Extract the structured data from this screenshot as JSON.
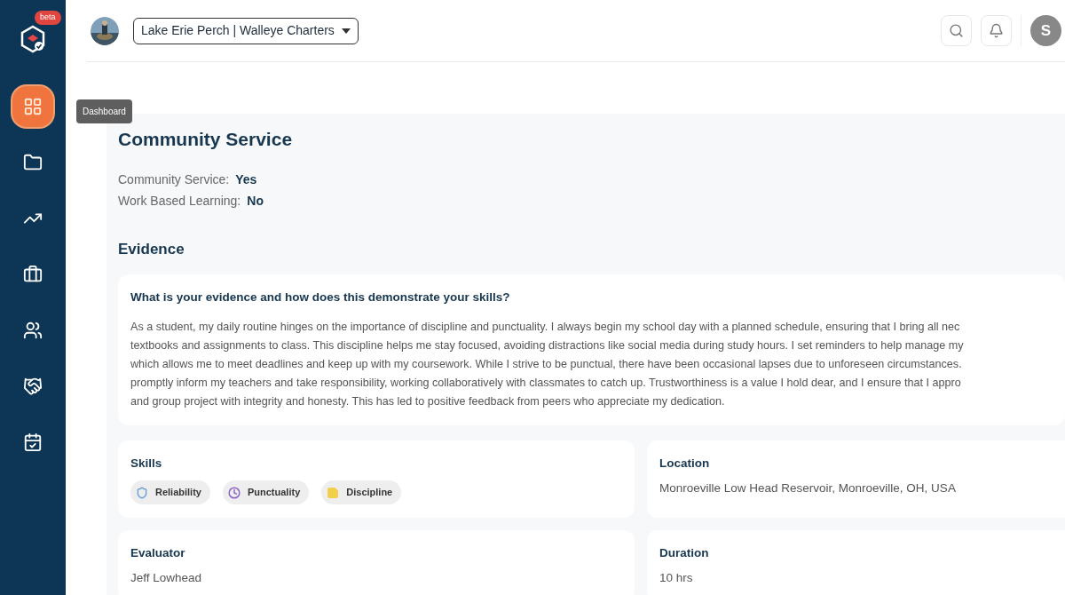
{
  "sidebar": {
    "badge": "beta",
    "items": [
      {
        "kind": "dashboard",
        "selected": true,
        "tooltip": "Dashboard"
      },
      {
        "kind": "folder",
        "selected": false
      },
      {
        "kind": "chart",
        "selected": false
      },
      {
        "kind": "briefcase",
        "selected": false
      },
      {
        "kind": "people",
        "selected": false
      },
      {
        "kind": "handshake",
        "selected": false
      },
      {
        "kind": "calendar",
        "selected": false
      }
    ]
  },
  "header": {
    "organization": "Lake Erie Perch | Walleye Charters",
    "user_initial": "S"
  },
  "page": {
    "title": "Community Service",
    "facts": [
      {
        "label": "Community Service:",
        "value": "Yes"
      },
      {
        "label": "Work Based Learning:",
        "value": "No"
      }
    ],
    "evidence_heading": "Evidence",
    "question": "What is your evidence and how does this demonstrate your skills?",
    "answer_lines": [
      "As a student, my daily routine hinges on the importance of discipline and punctuality. I always begin my school day with a planned schedule, ensuring that I bring all nec",
      "textbooks and assignments to class. This discipline helps me stay focused, avoiding distractions like social media during study hours. I set reminders to help manage my",
      "which allows me to meet deadlines and keep up with my coursework. While I strive to be punctual, there have been occasional lapses due to unforeseen circumstances.",
      "promptly inform my teachers and take responsibility, working collaboratively with classmates to catch up. Trustworthiness is a value I hold dear, and I ensure that I appro",
      "and group project with integrity and honesty. This has led to positive feedback from peers who appreciate my dedication."
    ],
    "skills": {
      "label": "Skills",
      "items": [
        {
          "name": "Reliability",
          "kind": "shield",
          "color": "#6fa3d8"
        },
        {
          "name": "Punctuality",
          "kind": "clock",
          "color": "#8a63c9"
        },
        {
          "name": "Discipline",
          "kind": "note",
          "color": "#f2cf4a"
        }
      ]
    },
    "location": {
      "label": "Location",
      "value": "Monroeville Low Head Reservoir, Monroeville, OH, USA"
    },
    "evaluator": {
      "label": "Evaluator",
      "value": "Jeff Lowhead"
    },
    "duration": {
      "label": "Duration",
      "value": "10 hrs"
    }
  }
}
